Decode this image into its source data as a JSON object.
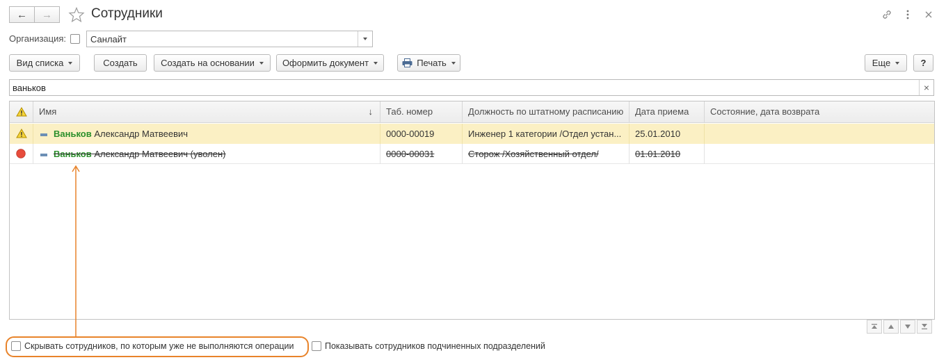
{
  "window": {
    "title": "Сотрудники",
    "back_label": "←",
    "forward_label": "→"
  },
  "org": {
    "label": "Организация:",
    "value": "Санлайт"
  },
  "toolbar": {
    "view_list": "Вид списка",
    "create": "Создать",
    "create_based": "Создать на основании",
    "make_doc": "Оформить документ",
    "print": "Печать",
    "more": "Еще",
    "help": "?"
  },
  "search": {
    "value": "ваньков",
    "clear": "×"
  },
  "table": {
    "columns": [
      "Имя",
      "Таб. номер",
      "Должность по штатному расписанию",
      "Дата приема",
      "Состояние, дата возврата"
    ],
    "sort_indicator": "↓",
    "rows": [
      {
        "name_highlight": "Ваньков",
        "name_rest": " Александр Матвеевич",
        "tab_no": "0000-00019",
        "position": "Инженер 1 категории /Отдел устан...",
        "hire_date": "25.01.2010",
        "status": "",
        "state": "warning"
      },
      {
        "name_highlight": "Ваньков",
        "name_rest": " Александр Матвеевич (уволен)",
        "tab_no": "0000-00031",
        "position": "Сторож /Хозяйственный отдел/",
        "hire_date": "01.01.2010",
        "status": "",
        "state": "dismissed"
      }
    ]
  },
  "footer": {
    "hide_label": "Скрывать сотрудников, по которым уже не выполняются операции",
    "show_sub_label": "Показывать сотрудников подчиненных подразделений"
  },
  "colors": {
    "row_selected": "#fbf0c4",
    "accent_orange": "#e8832a",
    "name_green": "#2b8f2b",
    "dismissed_red": "#e74c3c"
  }
}
